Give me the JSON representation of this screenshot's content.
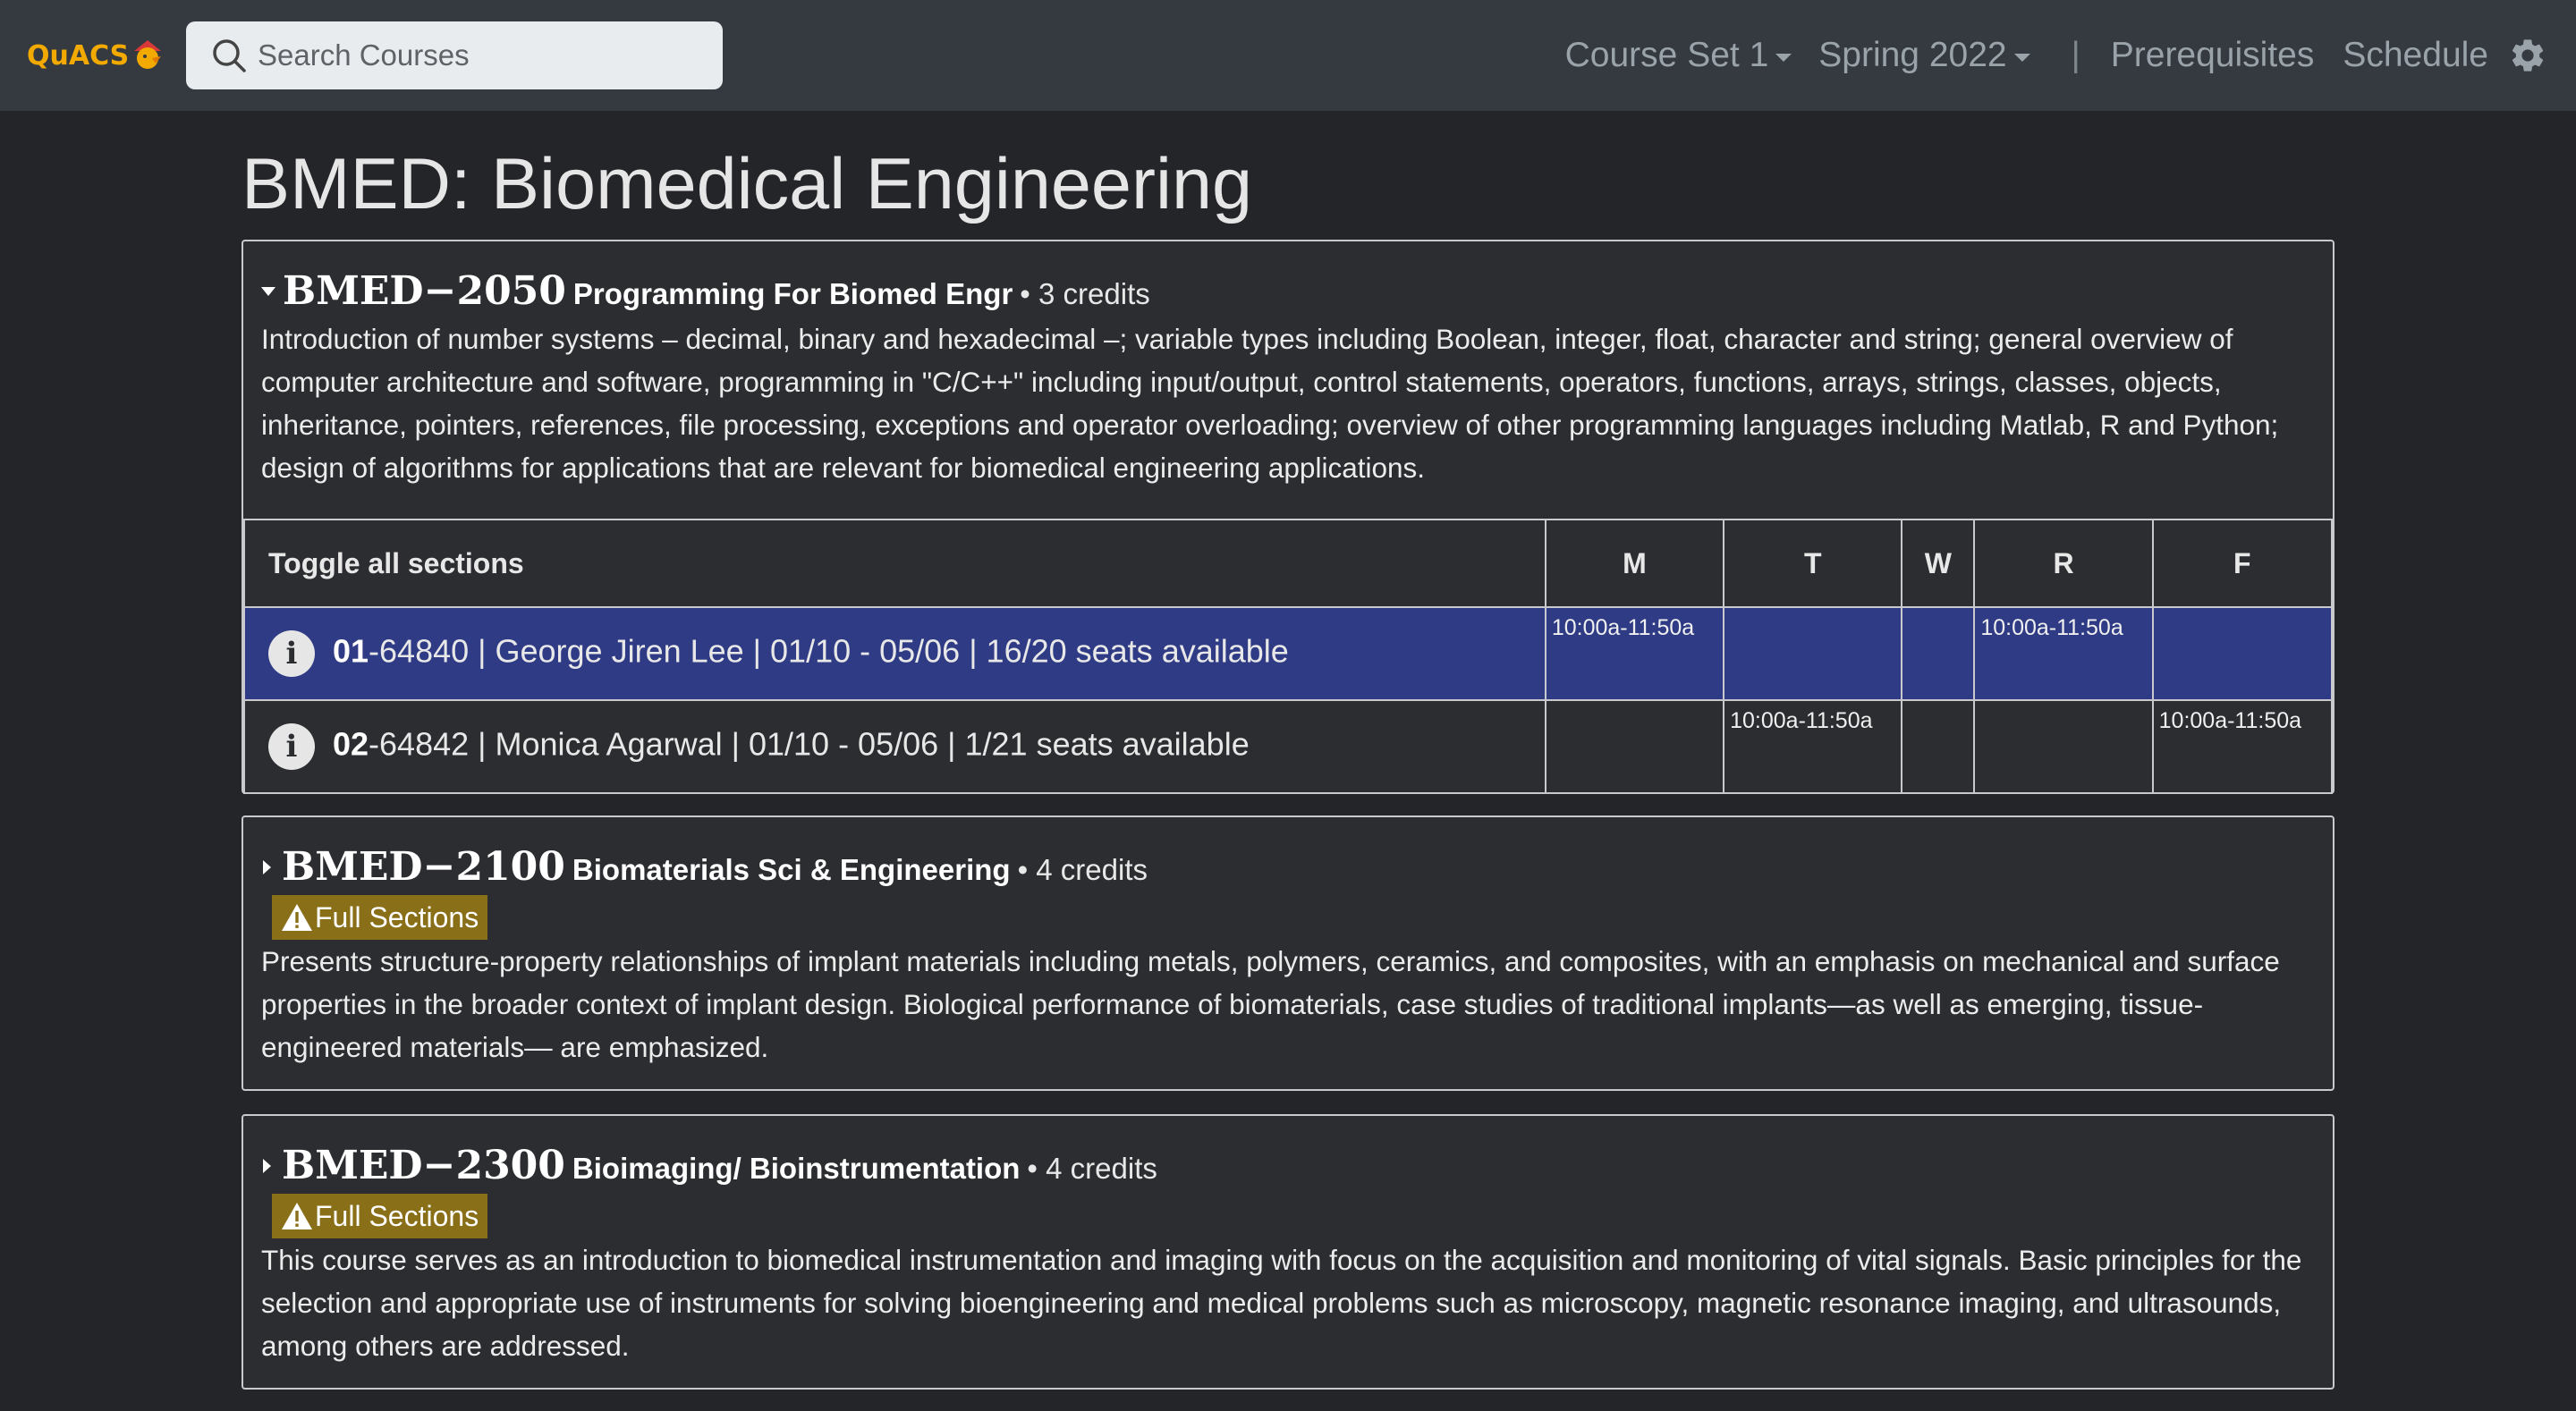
{
  "navbar": {
    "logo_text": "QuACS",
    "search_placeholder": "Search Courses",
    "course_set": "Course Set 1",
    "semester": "Spring 2022",
    "separator": "|",
    "prerequisites": "Prerequisites",
    "schedule": "Schedule",
    "settings_icon": "gear-icon"
  },
  "department": {
    "title": "BMED: Biomedical Engineering"
  },
  "courses": [
    {
      "code": "BMED−2050",
      "name": "Programming For Biomed Engr",
      "credits": "• 3 credits",
      "expanded": true,
      "description": "Introduction of number systems – decimal, binary and hexadecimal –; variable types including Boolean, integer, float, character and string; general overview of computer architecture and software, programming in \"C/C++\" including input/output, control statements, operators, functions, arrays, strings, classes, objects, inheritance, pointers, references, file processing, exceptions and operator overloading; overview of other programming languages including Matlab, R and Python; design of algorithms for applications that are relevant for biomedical engineering applications.",
      "sections_table": {
        "toggle_label": "Toggle all sections",
        "days": [
          "M",
          "T",
          "W",
          "R",
          "F"
        ],
        "rows": [
          {
            "section": "01",
            "rest": "-64840 | George Jiren Lee | 01/10 - 05/06 |  16/20 seats available",
            "selected": true,
            "times": [
              "10:00a-11:50a",
              "",
              "",
              "10:00a-11:50a",
              ""
            ]
          },
          {
            "section": "02",
            "rest": "-64842 | Monica Agarwal | 01/10 - 05/06 |  1/21 seats available",
            "selected": false,
            "times": [
              "",
              "10:00a-11:50a",
              "",
              "",
              "10:00a-11:50a"
            ]
          }
        ]
      }
    },
    {
      "code": "BMED−2100",
      "name": "Biomaterials Sci & Engineering",
      "credits": "• 4 credits",
      "expanded": false,
      "badge": "Full Sections",
      "description": "Presents structure-property relationships of implant materials including metals, polymers, ceramics, and composites, with an emphasis on mechanical and surface properties in the broader context of implant design. Biological performance of biomaterials, case studies of traditional implants—as well as emerging, tissue-engineered materials— are emphasized."
    },
    {
      "code": "BMED−2300",
      "name": "Bioimaging/ Bioinstrumentation",
      "credits": "• 4 credits",
      "expanded": false,
      "badge": "Full Sections",
      "description": "This course serves as an introduction to biomedical instrumentation and imaging with focus on the acquisition and monitoring of vital signals. Basic principles for the selection and appropriate use of instruments for solving bioengineering and medical problems such as microscopy, magnetic resonance imaging, and ultrasounds, among others are addressed."
    }
  ],
  "colors": {
    "navbar_bg": "#343a40",
    "page_bg": "#232529",
    "selected_row": "#2f3b84",
    "badge_bg": "#8a6f19",
    "logo": "#f2a900"
  }
}
